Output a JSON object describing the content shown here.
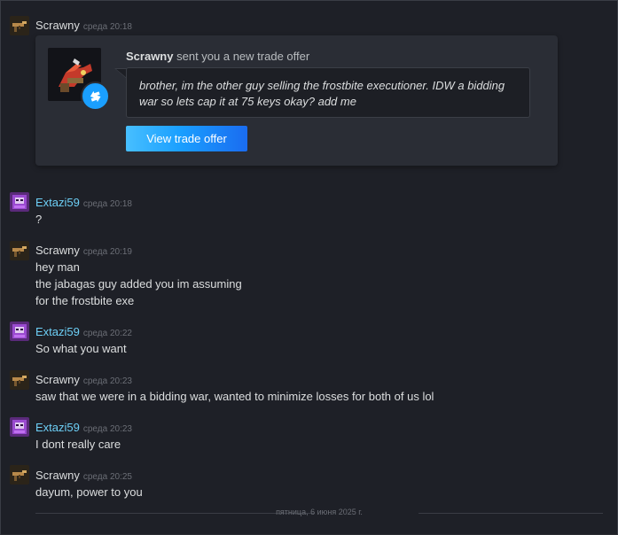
{
  "trade_offer": {
    "sender_name": "Scrawny",
    "title_suffix": "sent you a new trade offer",
    "message": "brother, im the other guy selling the frostbite executioner. IDW a bidding war so lets cap it at 75 keys okay? add me",
    "button_label": "View trade offer"
  },
  "messages": [
    {
      "author": "Scrawny",
      "time": "среда 20:18",
      "lines": []
    },
    {
      "author": "Extazi59",
      "time": "среда 20:18",
      "lines": [
        "?"
      ]
    },
    {
      "author": "Scrawny",
      "time": "среда 20:19",
      "lines": [
        "hey man",
        "the jabagas guy added you im assuming",
        "for the frostbite exe"
      ]
    },
    {
      "author": "Extazi59",
      "time": "среда 20:22",
      "lines": [
        "So what you want"
      ]
    },
    {
      "author": "Scrawny",
      "time": "среда 20:23",
      "lines": [
        "saw that we were in a bidding war, wanted to minimize losses for both of us lol"
      ]
    },
    {
      "author": "Extazi59",
      "time": "среда 20:23",
      "lines": [
        "I dont really care"
      ]
    },
    {
      "author": "Scrawny",
      "time": "среда 20:25",
      "lines": [
        "dayum, power to you"
      ]
    }
  ],
  "date_divider": "пятница, 6 июня 2025 г.",
  "colors": {
    "background": "#1e2027",
    "card": "#2a2d35",
    "friend_name_other": "#6dcff6",
    "button_blue": "#1a9fff"
  },
  "icons": {
    "trade_badge": "trade-arrows-icon",
    "scrawny_avatar": "gun-avatar",
    "extazi_avatar": "purple-helmet-avatar"
  }
}
